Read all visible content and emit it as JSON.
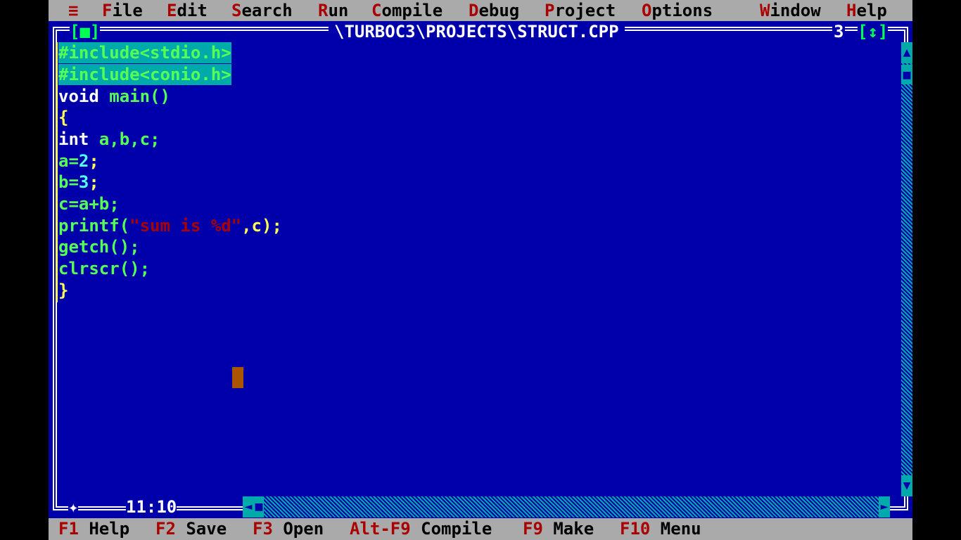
{
  "menu": {
    "system": "≡",
    "items": [
      {
        "hot": "F",
        "rest": "ile"
      },
      {
        "hot": "E",
        "rest": "dit"
      },
      {
        "hot": "S",
        "rest": "earch"
      },
      {
        "hot": "R",
        "rest": "un"
      },
      {
        "hot": "C",
        "rest": "ompile"
      },
      {
        "hot": "D",
        "rest": "ebug"
      },
      {
        "hot": "P",
        "rest": "roject"
      },
      {
        "hot": "O",
        "rest": "ptions"
      },
      {
        "hot": "W",
        "rest": "indow"
      },
      {
        "hot": "H",
        "rest": "elp"
      }
    ]
  },
  "window": {
    "close_box": "[■]",
    "title": "\\TURBOC3\\PROJECTS\\STRUCT.CPP",
    "number": "3",
    "zoom_box": "[↕]",
    "position": "11:10"
  },
  "code": {
    "line1": "#include<stdio.h>",
    "line2": "#include<conio.h>",
    "line3_kw": "void",
    "line3_rest": " main()",
    "line4": "{",
    "line5_kw": "int",
    "line5_rest": " a,b,c;",
    "line6_a": "a=",
    "line6_n": "2",
    "line6_e": ";",
    "line7_a": "b=",
    "line7_n": "3",
    "line7_e": ";",
    "line8": "c=a+b;",
    "line9_fn": "printf(",
    "line9_str": "\"sum is %d\"",
    "line9_rest": ",c);",
    "line10": "getch();",
    "line11": "clrscr();",
    "line12": "}"
  },
  "status": {
    "items": [
      {
        "key": "F1",
        "label": " Help"
      },
      {
        "key": "F2",
        "label": " Save"
      },
      {
        "key": "F3",
        "label": " Open"
      },
      {
        "key": "Alt-F9",
        "label": " Compile"
      },
      {
        "key": "F9",
        "label": " Make"
      },
      {
        "key": "F10",
        "label": " Menu"
      }
    ]
  },
  "colors": {
    "background": "#0000AA",
    "menu_bg": "#AAAAAA",
    "hotkey": "#AA0000",
    "cursor": "#AA5500"
  }
}
